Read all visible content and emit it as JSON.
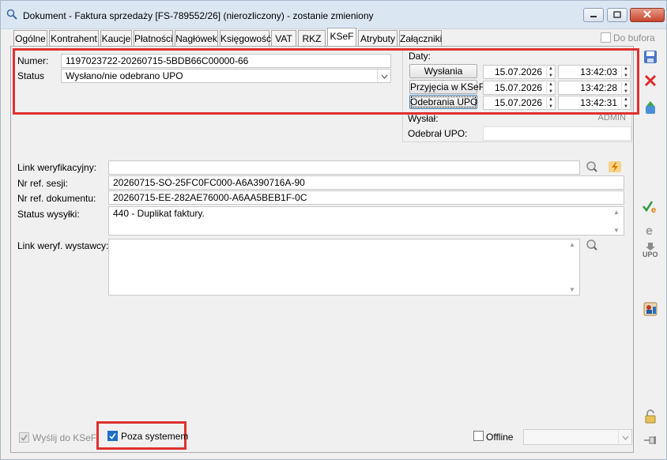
{
  "window": {
    "title": "Dokument - Faktura sprzedaży [FS-789552/26] (nierozliczony) - zostanie zmieniony"
  },
  "tabs": [
    {
      "label": "Ogólne"
    },
    {
      "label": "Kontrahent"
    },
    {
      "label": "Kaucje"
    },
    {
      "label": "Płatności"
    },
    {
      "label": "Nagłówek"
    },
    {
      "label": "Księgowość"
    },
    {
      "label": "VAT"
    },
    {
      "label": "RKZ"
    },
    {
      "label": "KSeF"
    },
    {
      "label": "Atrybuty"
    },
    {
      "label": "Załączniki"
    }
  ],
  "active_tab": "KSeF",
  "do_bufora": {
    "label": "Do bufora",
    "checked": false
  },
  "numer": {
    "label": "Numer:",
    "value": "1197023722-20260715-5BDB66C00000-66"
  },
  "status": {
    "label": "Status",
    "value": "Wysłano/nie odebrano UPO"
  },
  "daty": {
    "legend": "Daty:",
    "rows": [
      {
        "button": "Wysłania",
        "date": "15.07.2026",
        "time": "13:42:03"
      },
      {
        "button": "Przyjęcia w KSeF",
        "date": "15.07.2026",
        "time": "13:42:28"
      },
      {
        "button": "Odebrania UPO",
        "date": "15.07.2026",
        "time": "13:42:31"
      }
    ],
    "wyslal_label": "Wysłał:",
    "wyslal_value": "ADMIN",
    "odebral_label": "Odebrał UPO:",
    "odebral_value": ""
  },
  "link_weryfikacyjny": {
    "label": "Link weryfikacyjny:",
    "value": ""
  },
  "nr_ref_sesji": {
    "label": "Nr ref. sesji:",
    "value": "20260715-SO-25FC0FC000-A6A390716A-90"
  },
  "nr_ref_dokumentu": {
    "label": "Nr ref. dokumentu:",
    "value": "20260715-EE-282AE76000-A6AA5BEB1F-0C"
  },
  "status_wysylki": {
    "label": "Status wysyłki:",
    "value": "440 - Duplikat faktury."
  },
  "link_weryf_wystawcy": {
    "label": "Link weryf. wystawcy:",
    "value": ""
  },
  "wyslij_do_ksef": {
    "label": "Wyślij do KSeF",
    "checked": true
  },
  "poza_systemem": {
    "label": "Poza systemem",
    "checked": true
  },
  "offline": {
    "label": "Offline",
    "checked": false,
    "select_value": ""
  },
  "colors": {
    "highlight_red": "#e03030",
    "window_bg": "#f0f0f0",
    "accent_blue": "#1e6fc6"
  }
}
